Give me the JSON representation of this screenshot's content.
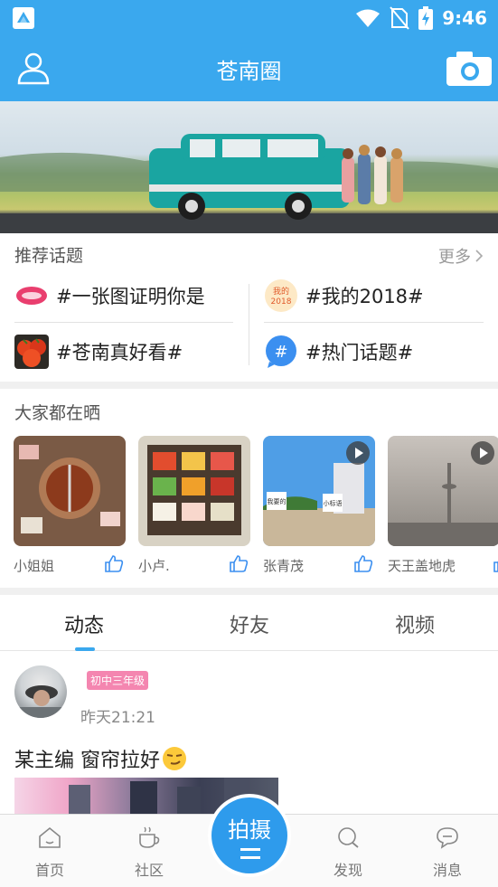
{
  "status_bar": {
    "time": "9:46"
  },
  "header": {
    "title": "苍南圈"
  },
  "topics": {
    "section_title": "推荐话题",
    "more_label": "更多",
    "items": [
      {
        "label": "#一张图证明你是",
        "icon": "lips-thumbnail"
      },
      {
        "label": "#我的2018#",
        "icon": "my-2018-thumbnail",
        "thumb_text": "我的 2018"
      },
      {
        "label": "#苍南真好看#",
        "icon": "tomato-thumbnail"
      },
      {
        "label": "#热门话题#",
        "icon": "hashtag-bubble-icon",
        "thumb_text": "#"
      }
    ]
  },
  "showcase": {
    "section_title": "大家都在晒",
    "cards": [
      {
        "name": "小姐姐",
        "is_video": false,
        "sign_texts": []
      },
      {
        "name": "小卢.",
        "is_video": false,
        "sign_texts": []
      },
      {
        "name": "张青茂",
        "is_video": true,
        "sign_texts": [
          "我要的",
          "小标语"
        ]
      },
      {
        "name": "天王盖地虎",
        "is_video": true,
        "sign_texts": []
      }
    ]
  },
  "feed": {
    "tabs": [
      "动态",
      "好友",
      "视频"
    ],
    "active_tab": 0,
    "post": {
      "grade_badge": "初中三年级",
      "time": "昨天21:21",
      "text": "某主编 窗帘拉好"
    }
  },
  "bottom_nav": {
    "items": [
      "首页",
      "社区",
      "发现",
      "消息"
    ],
    "center_label": "拍摄"
  },
  "colors": {
    "accent": "#3aa8ee",
    "badge_pink": "#f486b0"
  }
}
